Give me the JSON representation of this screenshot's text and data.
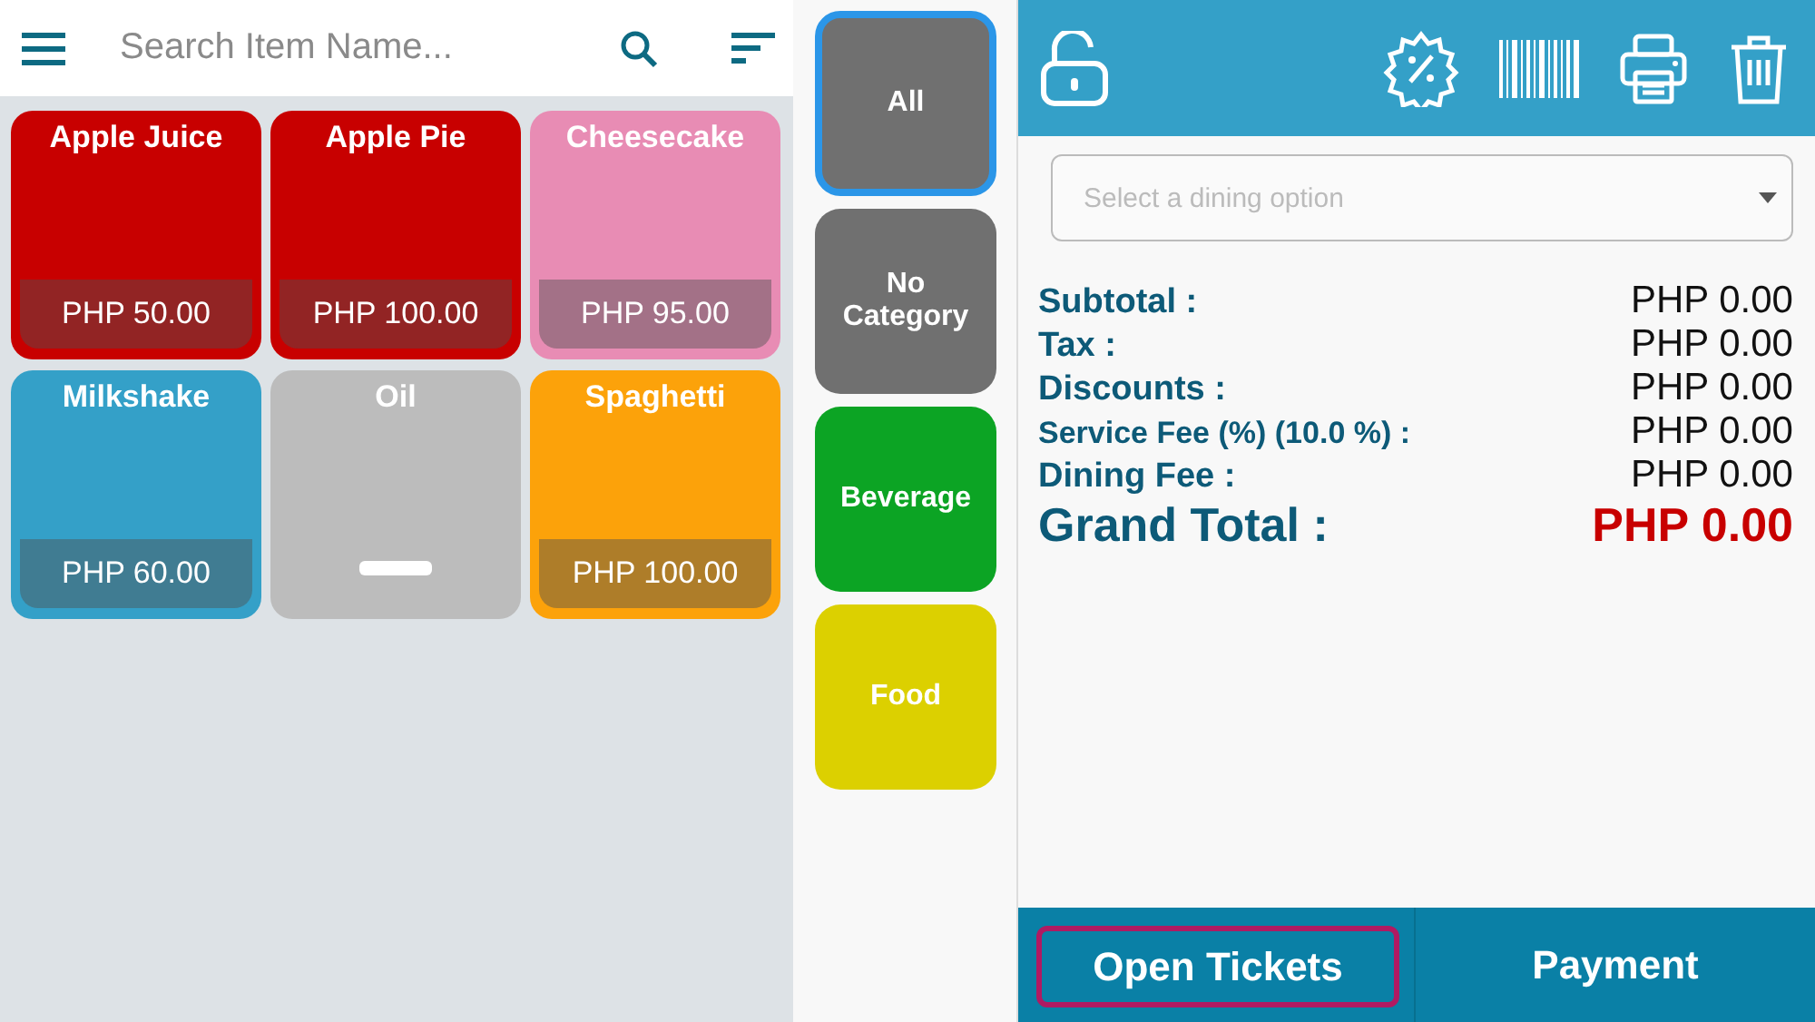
{
  "search": {
    "placeholder": "Search Item Name..."
  },
  "items": [
    {
      "name": "Apple Juice",
      "price": "PHP 50.00",
      "color": "#c80000"
    },
    {
      "name": "Apple Pie",
      "price": "PHP 100.00",
      "color": "#c80000"
    },
    {
      "name": "Cheesecake",
      "price": "PHP 95.00",
      "color": "#e88cb4"
    },
    {
      "name": "Milkshake",
      "price": "PHP 60.00",
      "color": "#34a0c8"
    },
    {
      "name": "Oil",
      "color": "#bcbcbc"
    },
    {
      "name": "Spaghetti",
      "price": "PHP 100.00",
      "color": "#fca20a"
    }
  ],
  "categories": [
    {
      "label": "All",
      "color": "#707070",
      "selected": true
    },
    {
      "label": "No Category",
      "color": "#707070",
      "selected": false
    },
    {
      "label": "Beverage",
      "color": "#0ca424",
      "selected": false
    },
    {
      "label": "Food",
      "color": "#dcd000",
      "selected": false
    }
  ],
  "dining_option": {
    "placeholder": "Select a dining option"
  },
  "totals": [
    {
      "kind": "line",
      "label": "Subtotal :",
      "value": "PHP 0.00"
    },
    {
      "kind": "line",
      "label": "Tax :",
      "value": "PHP 0.00"
    },
    {
      "kind": "line",
      "label": "Discounts :",
      "value": "PHP 0.00"
    },
    {
      "kind": "small",
      "label": "Service Fee (%) (10.0 %) :",
      "value": "PHP 0.00"
    },
    {
      "kind": "line",
      "label": "Dining Fee :",
      "value": "PHP 0.00"
    },
    {
      "kind": "grand",
      "label": "Grand Total :",
      "value": "PHP 0.00"
    }
  ],
  "buttons": [
    {
      "label": "Open Tickets",
      "focused": true
    },
    {
      "label": "Payment",
      "focused": false
    }
  ]
}
